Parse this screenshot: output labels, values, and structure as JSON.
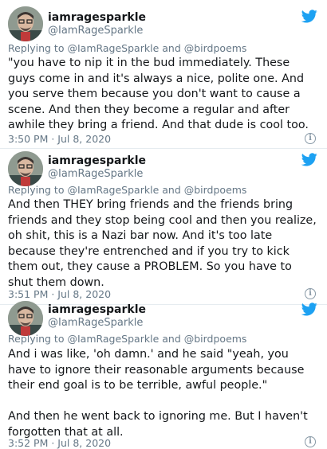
{
  "colors": {
    "twitter_blue": "#1da1f2",
    "secondary_text": "#657786",
    "primary_text": "#14171a"
  },
  "tweets": [
    {
      "display_name": "iamragesparkle",
      "handle": "@IamRageSparkle",
      "reply_prefix": "Replying to",
      "reply_users": "@IamRageSparkle and @birdpoems",
      "lines": [
        "\"you have to nip it in the bud immediately. These",
        "guys come in and it's always a nice, polite one. And",
        "you serve them because you don't want to cause a",
        "scene. And then they become a regular and after",
        "awhile they bring a friend. And that dude is cool too."
      ],
      "timestamp": "3:50 PM · Jul 8, 2020",
      "info_icon": "info-icon",
      "brand_icon": "twitter-bird-icon"
    },
    {
      "display_name": "iamragesparkle",
      "handle": "@IamRageSparkle",
      "reply_prefix": "Replying to",
      "reply_users": "@IamRageSparkle and @birdpoems",
      "lines": [
        "And then THEY bring friends and the friends bring",
        "friends and they stop being cool and then you realize,",
        "oh shit, this is a Nazi bar now. And it's too late",
        "because they're entrenched and if you try to kick",
        "them out, they cause a PROBLEM. So you have to",
        "shut them down."
      ],
      "timestamp": "3:51 PM · Jul 8, 2020",
      "info_icon": "info-icon",
      "brand_icon": "twitter-bird-icon"
    },
    {
      "display_name": "iamragesparkle",
      "handle": "@IamRageSparkle",
      "reply_prefix": "Replying to",
      "reply_users": "@IamRageSparkle and @birdpoems",
      "lines": [
        "And i was like, 'oh damn.' and he said \"yeah, you",
        "have to ignore their reasonable arguments because",
        "their end goal is to be terrible, awful people.\"",
        "",
        "And then he went back to ignoring me. But I haven't",
        "forgotten that at all."
      ],
      "timestamp": "3:52 PM · Jul 8, 2020",
      "info_icon": "info-icon",
      "brand_icon": "twitter-bird-icon"
    }
  ]
}
